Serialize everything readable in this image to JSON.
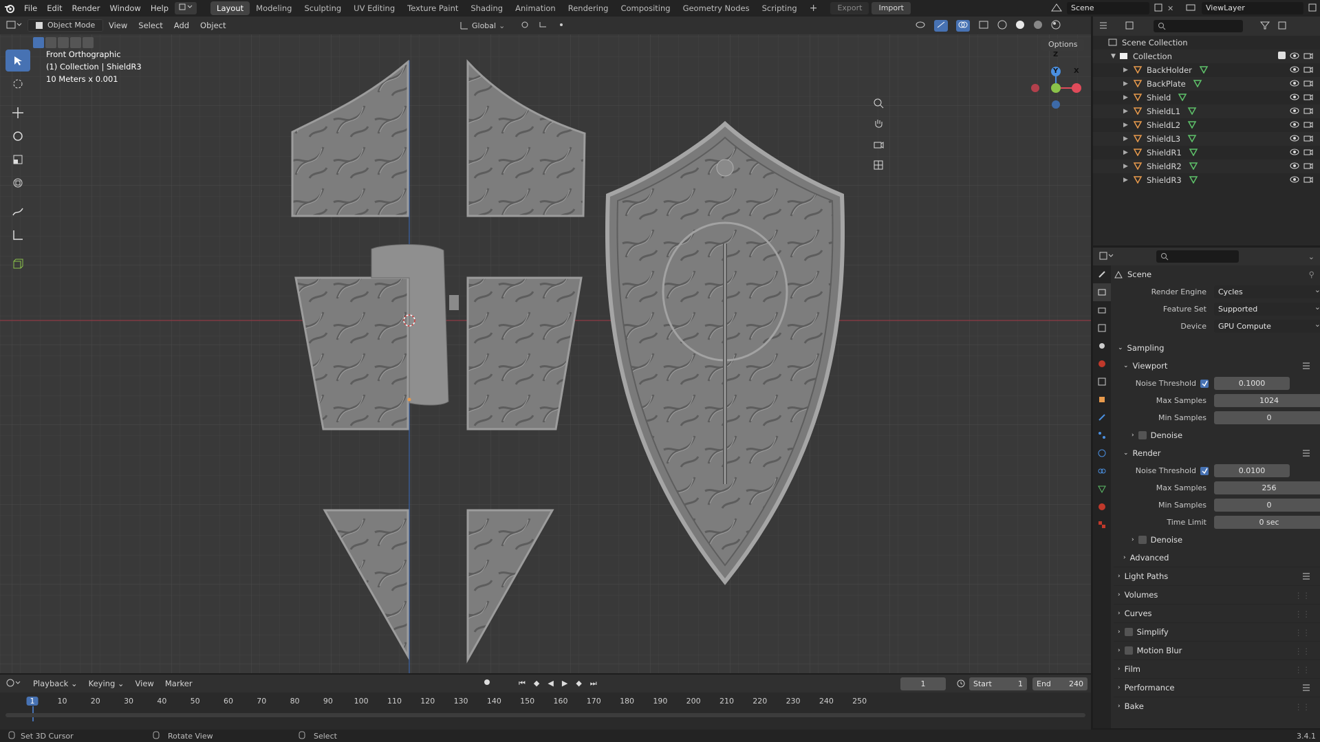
{
  "topbar": {
    "menus": [
      "File",
      "Edit",
      "Render",
      "Window",
      "Help"
    ],
    "workspaces": [
      "Layout",
      "Modeling",
      "Sculpting",
      "UV Editing",
      "Texture Paint",
      "Shading",
      "Animation",
      "Rendering",
      "Compositing",
      "Geometry Nodes",
      "Scripting"
    ],
    "active_workspace": "Layout",
    "export_label": "Export",
    "import_label": "Import",
    "scene_name": "Scene",
    "view_layer": "ViewLayer"
  },
  "viewport": {
    "mode": "Object Mode",
    "menus": [
      "View",
      "Select",
      "Add",
      "Object"
    ],
    "transform_orientation": "Global",
    "options_label": "Options",
    "overlay_lines": [
      "Front Orthographic",
      "(1) Collection | ShieldR3",
      "10 Meters x 0.001"
    ],
    "axis_labels": {
      "z": "Z",
      "y": "Y",
      "x": "X"
    }
  },
  "outliner": {
    "root": "Scene Collection",
    "collection": "Collection",
    "objects": [
      "BackHolder",
      "BackPlate",
      "Shield",
      "ShieldL1",
      "ShieldL2",
      "ShieldL3",
      "ShieldR1",
      "ShieldR2",
      "ShieldR3"
    ]
  },
  "properties": {
    "title": "Scene",
    "render_engine_label": "Render Engine",
    "render_engine": "Cycles",
    "feature_set_label": "Feature Set",
    "feature_set": "Supported",
    "device_label": "Device",
    "device": "GPU Compute",
    "sampling": "Sampling",
    "viewport": {
      "title": "Viewport",
      "noise_threshold_label": "Noise Threshold",
      "noise_threshold": "0.1000",
      "max_samples_label": "Max Samples",
      "max_samples": "1024",
      "min_samples_label": "Min Samples",
      "min_samples": "0",
      "denoise": "Denoise"
    },
    "render": {
      "title": "Render",
      "noise_threshold_label": "Noise Threshold",
      "noise_threshold": "0.0100",
      "max_samples_label": "Max Samples",
      "max_samples": "256",
      "min_samples_label": "Min Samples",
      "min_samples": "0",
      "time_limit_label": "Time Limit",
      "time_limit": "0 sec",
      "denoise": "Denoise"
    },
    "advanced": "Advanced",
    "sections": [
      "Light Paths",
      "Volumes",
      "Curves",
      "Simplify",
      "Motion Blur",
      "Film",
      "Performance",
      "Bake"
    ]
  },
  "timeline": {
    "menus": [
      "Playback",
      "Keying",
      "View",
      "Marker"
    ],
    "current_frame": "1",
    "start_label": "Start",
    "start": "1",
    "end_label": "End",
    "end": "240",
    "ticks": [
      "1",
      "10",
      "20",
      "30",
      "40",
      "50",
      "60",
      "70",
      "80",
      "90",
      "100",
      "110",
      "120",
      "130",
      "140",
      "150",
      "160",
      "170",
      "180",
      "190",
      "200",
      "210",
      "220",
      "230",
      "240",
      "250"
    ]
  },
  "statusbar": {
    "left": "Set 3D Cursor",
    "middle": "Rotate View",
    "right": "Select",
    "version": "3.4.1"
  },
  "colors": {
    "accent": "#4772b3",
    "object_orange": "#e89a4c",
    "mesh_green": "#5ec26a",
    "x_axis": "#e04b5a",
    "y_axis": "#8bc34a",
    "z_axis": "#4a8fe0"
  }
}
